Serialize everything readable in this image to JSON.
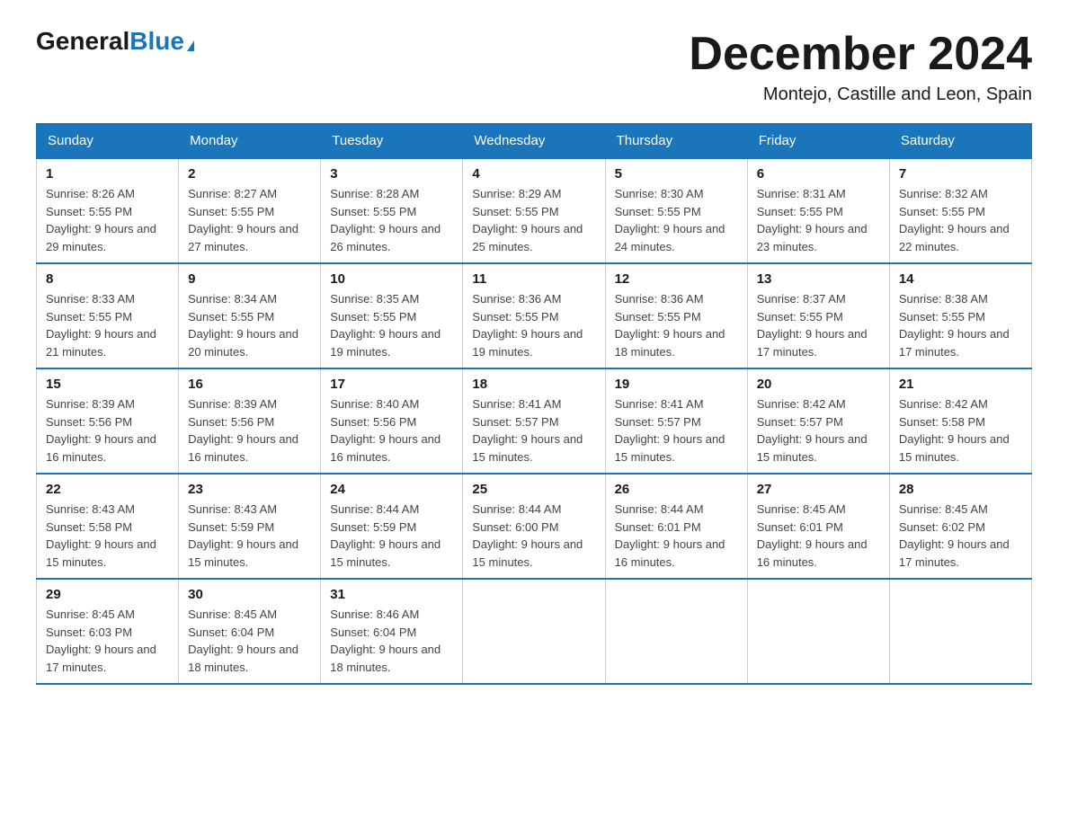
{
  "header": {
    "logo_general": "General",
    "logo_blue": "Blue",
    "month_title": "December 2024",
    "location": "Montejo, Castille and Leon, Spain"
  },
  "days_of_week": [
    "Sunday",
    "Monday",
    "Tuesday",
    "Wednesday",
    "Thursday",
    "Friday",
    "Saturday"
  ],
  "weeks": [
    [
      {
        "day": "1",
        "sunrise": "8:26 AM",
        "sunset": "5:55 PM",
        "daylight": "9 hours and 29 minutes."
      },
      {
        "day": "2",
        "sunrise": "8:27 AM",
        "sunset": "5:55 PM",
        "daylight": "9 hours and 27 minutes."
      },
      {
        "day": "3",
        "sunrise": "8:28 AM",
        "sunset": "5:55 PM",
        "daylight": "9 hours and 26 minutes."
      },
      {
        "day": "4",
        "sunrise": "8:29 AM",
        "sunset": "5:55 PM",
        "daylight": "9 hours and 25 minutes."
      },
      {
        "day": "5",
        "sunrise": "8:30 AM",
        "sunset": "5:55 PM",
        "daylight": "9 hours and 24 minutes."
      },
      {
        "day": "6",
        "sunrise": "8:31 AM",
        "sunset": "5:55 PM",
        "daylight": "9 hours and 23 minutes."
      },
      {
        "day": "7",
        "sunrise": "8:32 AM",
        "sunset": "5:55 PM",
        "daylight": "9 hours and 22 minutes."
      }
    ],
    [
      {
        "day": "8",
        "sunrise": "8:33 AM",
        "sunset": "5:55 PM",
        "daylight": "9 hours and 21 minutes."
      },
      {
        "day": "9",
        "sunrise": "8:34 AM",
        "sunset": "5:55 PM",
        "daylight": "9 hours and 20 minutes."
      },
      {
        "day": "10",
        "sunrise": "8:35 AM",
        "sunset": "5:55 PM",
        "daylight": "9 hours and 19 minutes."
      },
      {
        "day": "11",
        "sunrise": "8:36 AM",
        "sunset": "5:55 PM",
        "daylight": "9 hours and 19 minutes."
      },
      {
        "day": "12",
        "sunrise": "8:36 AM",
        "sunset": "5:55 PM",
        "daylight": "9 hours and 18 minutes."
      },
      {
        "day": "13",
        "sunrise": "8:37 AM",
        "sunset": "5:55 PM",
        "daylight": "9 hours and 17 minutes."
      },
      {
        "day": "14",
        "sunrise": "8:38 AM",
        "sunset": "5:55 PM",
        "daylight": "9 hours and 17 minutes."
      }
    ],
    [
      {
        "day": "15",
        "sunrise": "8:39 AM",
        "sunset": "5:56 PM",
        "daylight": "9 hours and 16 minutes."
      },
      {
        "day": "16",
        "sunrise": "8:39 AM",
        "sunset": "5:56 PM",
        "daylight": "9 hours and 16 minutes."
      },
      {
        "day": "17",
        "sunrise": "8:40 AM",
        "sunset": "5:56 PM",
        "daylight": "9 hours and 16 minutes."
      },
      {
        "day": "18",
        "sunrise": "8:41 AM",
        "sunset": "5:57 PM",
        "daylight": "9 hours and 15 minutes."
      },
      {
        "day": "19",
        "sunrise": "8:41 AM",
        "sunset": "5:57 PM",
        "daylight": "9 hours and 15 minutes."
      },
      {
        "day": "20",
        "sunrise": "8:42 AM",
        "sunset": "5:57 PM",
        "daylight": "9 hours and 15 minutes."
      },
      {
        "day": "21",
        "sunrise": "8:42 AM",
        "sunset": "5:58 PM",
        "daylight": "9 hours and 15 minutes."
      }
    ],
    [
      {
        "day": "22",
        "sunrise": "8:43 AM",
        "sunset": "5:58 PM",
        "daylight": "9 hours and 15 minutes."
      },
      {
        "day": "23",
        "sunrise": "8:43 AM",
        "sunset": "5:59 PM",
        "daylight": "9 hours and 15 minutes."
      },
      {
        "day": "24",
        "sunrise": "8:44 AM",
        "sunset": "5:59 PM",
        "daylight": "9 hours and 15 minutes."
      },
      {
        "day": "25",
        "sunrise": "8:44 AM",
        "sunset": "6:00 PM",
        "daylight": "9 hours and 15 minutes."
      },
      {
        "day": "26",
        "sunrise": "8:44 AM",
        "sunset": "6:01 PM",
        "daylight": "9 hours and 16 minutes."
      },
      {
        "day": "27",
        "sunrise": "8:45 AM",
        "sunset": "6:01 PM",
        "daylight": "9 hours and 16 minutes."
      },
      {
        "day": "28",
        "sunrise": "8:45 AM",
        "sunset": "6:02 PM",
        "daylight": "9 hours and 17 minutes."
      }
    ],
    [
      {
        "day": "29",
        "sunrise": "8:45 AM",
        "sunset": "6:03 PM",
        "daylight": "9 hours and 17 minutes."
      },
      {
        "day": "30",
        "sunrise": "8:45 AM",
        "sunset": "6:04 PM",
        "daylight": "9 hours and 18 minutes."
      },
      {
        "day": "31",
        "sunrise": "8:46 AM",
        "sunset": "6:04 PM",
        "daylight": "9 hours and 18 minutes."
      },
      null,
      null,
      null,
      null
    ]
  ]
}
